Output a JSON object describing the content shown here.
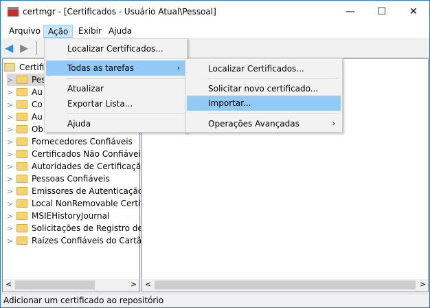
{
  "window": {
    "title": "certmgr - [Certificados - Usuário Atual\\Pessoal]",
    "minimize": "—",
    "maximize": "☐",
    "close": "✕"
  },
  "menubar": [
    "Arquivo",
    "Ação",
    "Exibir",
    "Ajuda"
  ],
  "toolbar": {
    "back_icon": "arrow-left",
    "forward_icon": "arrow-right"
  },
  "tree": {
    "root": "Certific",
    "items": [
      "Pes",
      "Au",
      "Co",
      "Au",
      "Ob",
      "Fornecedores Confiáveis",
      "Certificados Não Confiáveis",
      "Autoridades de Certificação R",
      "Pessoas Confiáveis",
      "Emissores de Autenticação de",
      "Local NonRemovable Certific",
      "MSIEHistoryJournal",
      "Solicitações de Registro de Ce",
      "Raízes Confiáveis do Cartão In"
    ]
  },
  "action_menu": {
    "items": [
      "Localizar Certificados...",
      "Todas as tarefas",
      "Atualizar",
      "Exportar Lista...",
      "Ajuda"
    ]
  },
  "submenu": {
    "items": [
      "Localizar Certificados...",
      "Solicitar novo certificado...",
      "Importar...",
      "Operações Avançadas"
    ]
  },
  "status": "Adicionar um certificado ao repositório",
  "colors": {
    "highlight": "#91c9f7",
    "border": "#1a7fd4"
  }
}
